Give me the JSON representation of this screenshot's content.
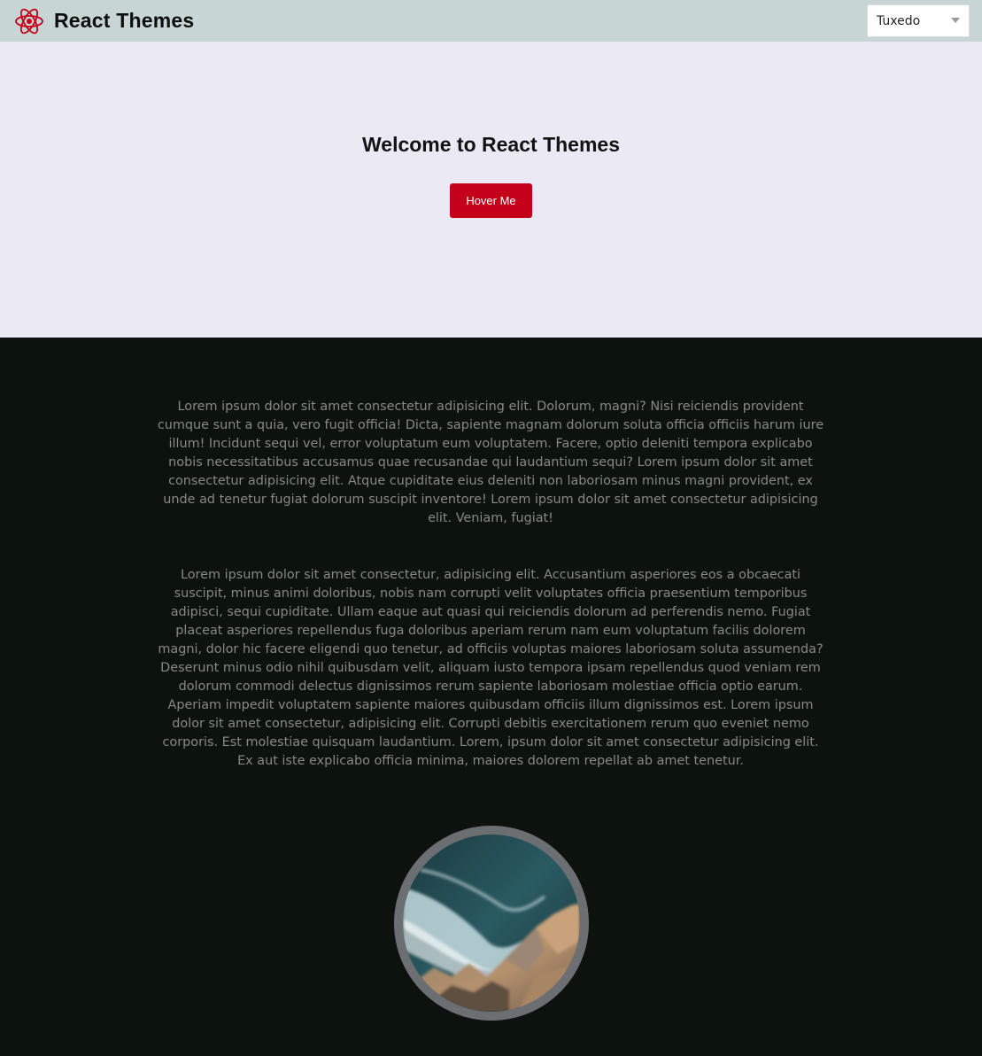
{
  "navbar": {
    "brand_title": "React Themes",
    "logo_icon": "react-atom-icon",
    "theme_select": {
      "selected": "Tuxedo"
    }
  },
  "hero": {
    "title": "Welcome to React Themes",
    "button_label": "Hover Me"
  },
  "content": {
    "paragraph_1": "Lorem ipsum dolor sit amet consectetur adipisicing elit. Dolorum, magni? Nisi reiciendis provident cumque sunt a quia, vero fugit officia! Dicta, sapiente magnam dolorum soluta officia officiis harum iure illum! Incidunt sequi vel, error voluptatum eum voluptatem. Facere, optio deleniti tempora explicabo nobis necessitatibus accusamus quae recusandae qui laudantium sequi? Lorem ipsum dolor sit amet consectetur adipisicing elit. Atque cupiditate eius deleniti non laboriosam minus magni provident, ex unde ad tenetur fugiat dolorum suscipit inventore! Lorem ipsum dolor sit amet consectetur adipisicing elit. Veniam, fugiat!",
    "paragraph_2": "Lorem ipsum dolor sit amet consectetur, adipisicing elit. Accusantium asperiores eos a obcaecati suscipit, minus animi doloribus, nobis nam corrupti velit voluptates officia praesentium temporibus adipisci, sequi cupiditate. Ullam eaque aut quasi qui reiciendis dolorum ad perferendis nemo. Fugiat placeat asperiores repellendus fuga doloribus aperiam rerum nam eum voluptatum facilis dolorem magni, dolor hic facere eligendi quo tenetur, ad officiis voluptas maiores laboriosam soluta assumenda? Deserunt minus odio nihil quibusdam velit, aliquam iusto tempora ipsam repellendus quod veniam rem dolorum commodi delectus dignissimos rerum sapiente laboriosam molestiae officia optio earum. Aperiam impedit voluptatem sapiente maiores quibusdam officiis illum dignissimos est. Lorem ipsum dolor sit amet consectetur, adipisicing elit. Corrupti debitis exercitationem rerum quo eveniet nemo corporis. Est molestiae quisquam laudantium. Lorem, ipsum dolor sit amet consectetur adipisicing elit. Ex aut iste explicabo officia minima, maiores dolorem repellat ab amet tenetur.",
    "image_subject": "ocean-rocks-photo"
  },
  "colors": {
    "navbar_bg": "#c7d5d4",
    "hero_bg": "#ebe9f4",
    "accent": "#c4001a",
    "content_bg": "#0c120e",
    "paragraph_text": "#858a87"
  }
}
